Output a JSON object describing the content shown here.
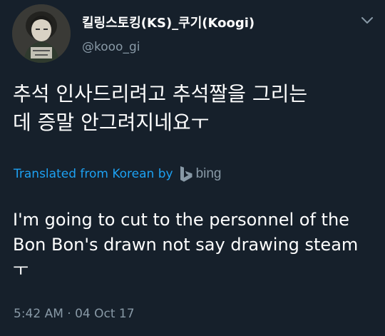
{
  "tweet": {
    "display_name": "킬링스토킹(KS)_쿠기(Koogi)",
    "handle": "@kooo_gi",
    "text_line1": "추석 인사드리려고 추석짤을 그리는",
    "text_line2": "데 증말 안그려지네요ㅜ",
    "translated_label": "Translated from Korean by",
    "translation_provider": "bing",
    "translation_line1": "I'm going to cut to the personnel of the",
    "translation_line2": "Bon Bon's drawn not say drawing steam",
    "translation_line3": "ㅜ",
    "timestamp": "5:42 AM · 04 Oct 17"
  },
  "icons": {
    "menu": "chevron-down-icon",
    "avatar": "avatar",
    "bing": "bing-logo-icon"
  },
  "colors": {
    "background": "#16202b",
    "text": "#ffffff",
    "muted": "#8899a6",
    "link": "#1da1f2"
  }
}
